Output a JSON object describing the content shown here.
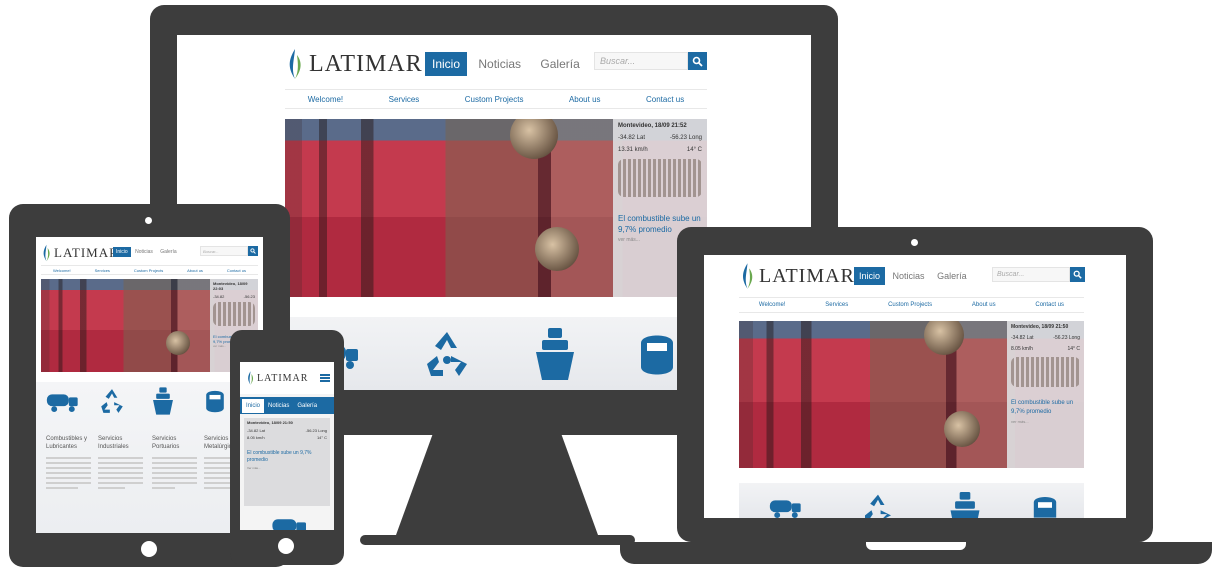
{
  "brand": {
    "name": "LATIMAR",
    "accent": "#1c6aa3",
    "device_color": "#3d3d3d"
  },
  "nav": {
    "tabs": [
      "Inicio",
      "Noticias",
      "Galería"
    ]
  },
  "search": {
    "placeholder": "Buscar..."
  },
  "subnav": [
    "Welcome!",
    "Services",
    "Custom Projects",
    "About us",
    "Contact us"
  ],
  "hero": {
    "location_time": "Montevideo, 18/09 21:52",
    "lat": "-34.82 Lat",
    "long": "-56.23 Long",
    "wind": "13.31 km/h",
    "temp": "14° C",
    "headline": "El combustible sube un 9,7% promedio",
    "more": "ver más..."
  },
  "laptop_hero": {
    "location_time": "Montevideo, 18/09 21:50",
    "lat": "-34.82 Lat",
    "long": "-56.23 Long",
    "wind": "8.05 km/h",
    "temp": "14° C",
    "headline": "El combustible sube un 9,7% promedio",
    "more": "ver más..."
  },
  "tablet_hero": {
    "location_time": "Montevideo, 18/09 22:03",
    "lat": "-34.82",
    "long": "-56.23",
    "headline": "El combustible sube un 9,7% promedio",
    "more": "ver más..."
  },
  "phone_hero": {
    "location_time": "Montevideo, 18/09 21:50",
    "lat": "-34.82 Lat",
    "long": "-56.23 Long",
    "wind": "8.05 km/h",
    "temp": "14° C",
    "headline": "El combustible sube un 9,7% promedio",
    "more": "Ver más..."
  },
  "services": [
    {
      "title": "Combustibles y Lubricantes",
      "icon": "truck-icon"
    },
    {
      "title": "Servicios Industriales",
      "icon": "recycle-icon"
    },
    {
      "title": "Servicios Portuarios",
      "icon": "ship-icon"
    },
    {
      "title": "Servicios Metalúrgicos",
      "icon": "welding-mask-icon"
    }
  ]
}
